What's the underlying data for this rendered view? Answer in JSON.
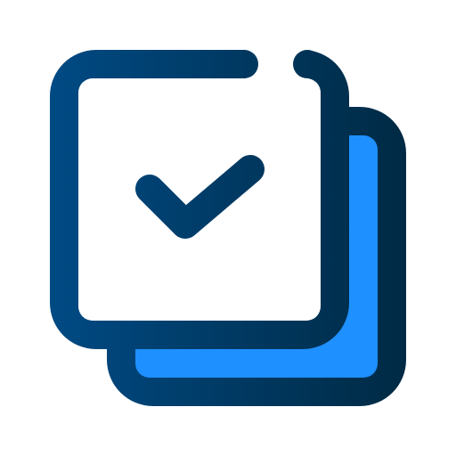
{
  "icon": {
    "name": "copy-check-icon",
    "colors": {
      "outline_start": "#004a84",
      "outline_end": "#002a44",
      "back_fill": "#1e90ff",
      "front_fill": "#ffffff",
      "background": "#ffffff"
    }
  }
}
